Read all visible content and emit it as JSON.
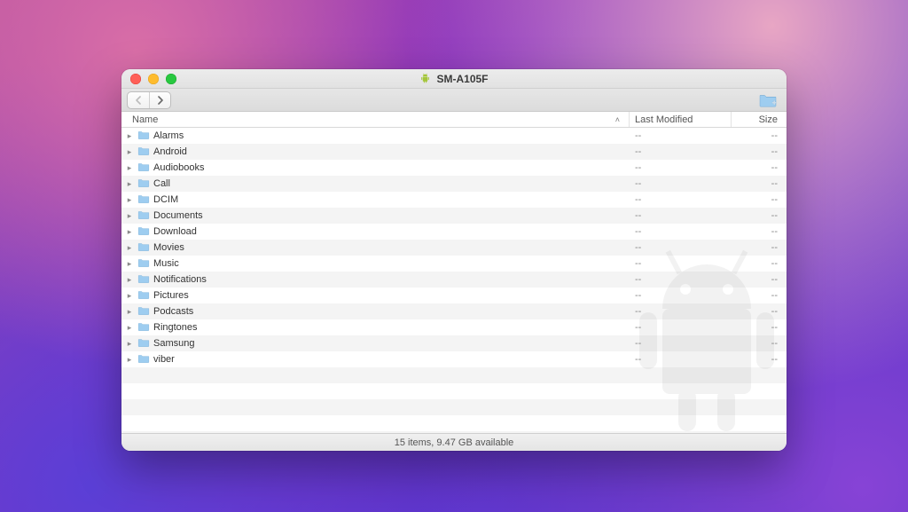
{
  "window": {
    "title": "SM-A105F"
  },
  "columns": {
    "name": "Name",
    "last_modified": "Last Modified",
    "size": "Size",
    "sort_indicator": "˄"
  },
  "rows": [
    {
      "name": "Alarms",
      "modified": "--",
      "size": "--"
    },
    {
      "name": "Android",
      "modified": "--",
      "size": "--"
    },
    {
      "name": "Audiobooks",
      "modified": "--",
      "size": "--"
    },
    {
      "name": "Call",
      "modified": "--",
      "size": "--"
    },
    {
      "name": "DCIM",
      "modified": "--",
      "size": "--"
    },
    {
      "name": "Documents",
      "modified": "--",
      "size": "--"
    },
    {
      "name": "Download",
      "modified": "--",
      "size": "--"
    },
    {
      "name": "Movies",
      "modified": "--",
      "size": "--"
    },
    {
      "name": "Music",
      "modified": "--",
      "size": "--"
    },
    {
      "name": "Notifications",
      "modified": "--",
      "size": "--"
    },
    {
      "name": "Pictures",
      "modified": "--",
      "size": "--"
    },
    {
      "name": "Podcasts",
      "modified": "--",
      "size": "--"
    },
    {
      "name": "Ringtones",
      "modified": "--",
      "size": "--"
    },
    {
      "name": "Samsung",
      "modified": "--",
      "size": "--"
    },
    {
      "name": "viber",
      "modified": "--",
      "size": "--"
    }
  ],
  "status": {
    "text": "15 items, 9.47 GB available"
  },
  "icons": {
    "android_color": "#A4C639",
    "folder_fill": "#7FB8E8",
    "folder_tab": "#5A9BD4"
  }
}
